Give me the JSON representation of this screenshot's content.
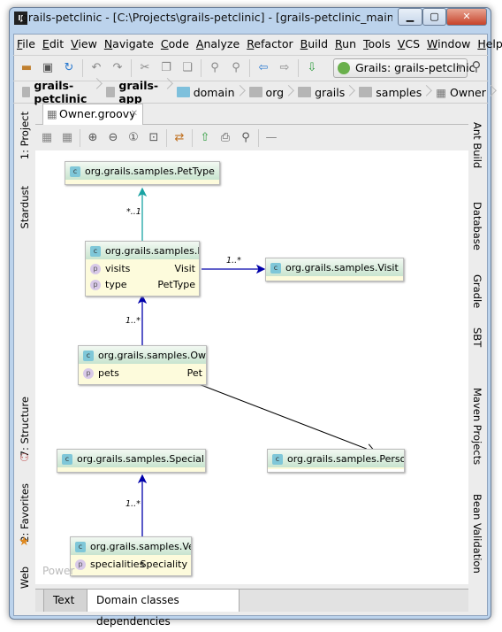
{
  "window": {
    "title": "grails-petclinic - [C:\\Projects\\grails-petclinic] - [grails-petclinic_main] - ...\\gr...",
    "logo": "IJ",
    "controls": [
      "minimize",
      "maximize",
      "close"
    ]
  },
  "menu": [
    "File",
    "Edit",
    "View",
    "Navigate",
    "Code",
    "Analyze",
    "Refactor",
    "Build",
    "Run",
    "Tools",
    "VCS",
    "Window",
    "Help"
  ],
  "toolbar": {
    "run_config": "Grails: grails-petclinic"
  },
  "breadcrumbs": [
    "grails-petclinic",
    "grails-app",
    "domain",
    "org",
    "grails",
    "samples",
    "Owner"
  ],
  "left_tools": [
    "1: Project",
    "Stardust",
    "7: Structure",
    "2: Favorites",
    "Web"
  ],
  "right_tools": [
    "Ant Build",
    "Database",
    "Gradle",
    "SBT",
    "Maven Projects",
    "Bean Validation"
  ],
  "editor_tab": "Owner.groovy",
  "diagram": {
    "nodes": {
      "pettype": {
        "name": "org.grails.samples.PetType"
      },
      "pet": {
        "name": "org.grails.samples.Pet",
        "fields": [
          {
            "name": "visits",
            "type": "Visit"
          },
          {
            "name": "type",
            "type": "PetType"
          }
        ]
      },
      "visit": {
        "name": "org.grails.samples.Visit"
      },
      "owner": {
        "name": "org.grails.samples.Owner",
        "fields": [
          {
            "name": "pets",
            "type": "Pet"
          }
        ]
      },
      "speciality": {
        "name": "org.grails.samples.Speciality"
      },
      "person": {
        "name": "org.grails.samples.Person"
      },
      "vet": {
        "name": "org.grails.samples.Vet",
        "fields": [
          {
            "name": "specialities",
            "type": "Speciality"
          }
        ]
      }
    },
    "edges": [
      {
        "from": "pet",
        "to": "pettype",
        "label": "*..1",
        "color": "#1aa3a3"
      },
      {
        "from": "pet",
        "to": "visit",
        "label": "1..*",
        "color": "#0000aa"
      },
      {
        "from": "owner",
        "to": "pet",
        "label": "1..*",
        "color": "#0000aa"
      },
      {
        "from": "owner",
        "to": "person",
        "label": "",
        "color": "#000000"
      },
      {
        "from": "vet",
        "to": "speciality",
        "label": "1..*",
        "color": "#0000aa"
      }
    ],
    "watermark": "Power"
  },
  "bottom_tabs": [
    "Text",
    "Domain classes dependencies"
  ],
  "active_bottom_tab": "Domain classes dependencies"
}
